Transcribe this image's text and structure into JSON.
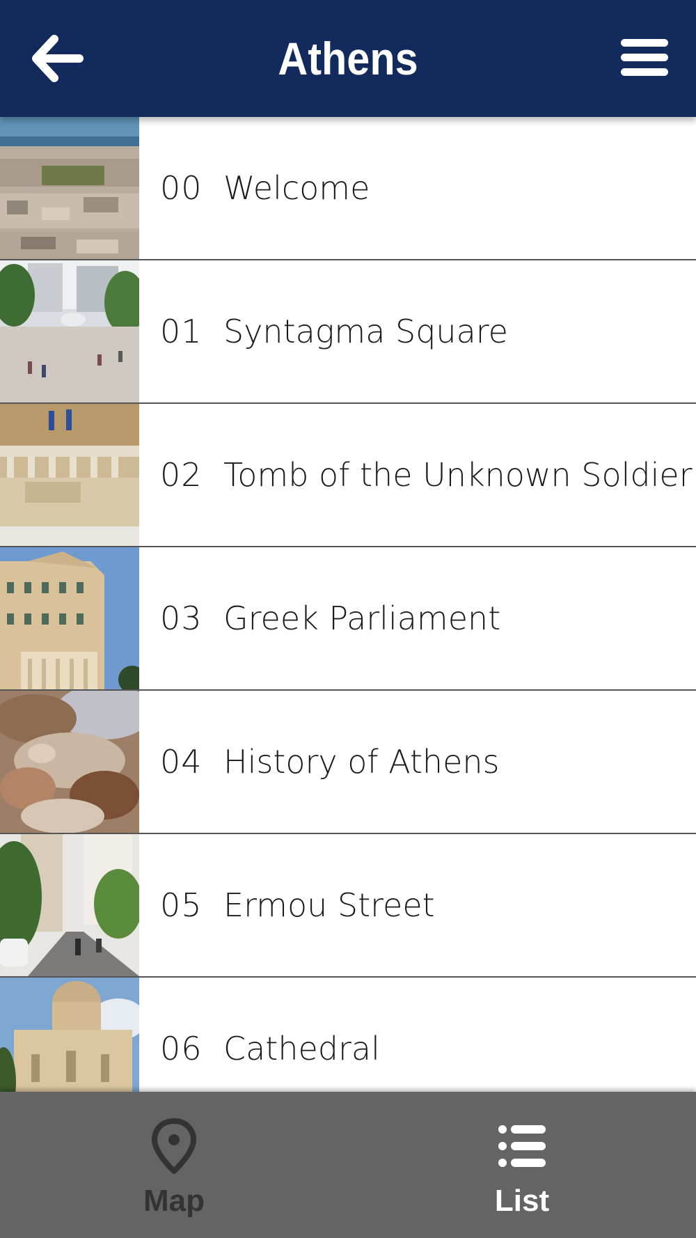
{
  "header": {
    "title": "Athens",
    "back_icon": "arrow-left-icon",
    "menu_icon": "hamburger-menu-icon",
    "background_color": "#122a5c"
  },
  "list": {
    "items": [
      {
        "number": "00",
        "title": "Welcome",
        "thumbnail": "city-aerial-photo"
      },
      {
        "number": "01",
        "title": "Syntagma Square",
        "thumbnail": "square-photo"
      },
      {
        "number": "02",
        "title": "Tomb of the Unknown Soldier",
        "thumbnail": "monument-photo"
      },
      {
        "number": "03",
        "title": "Greek Parliament",
        "thumbnail": "parliament-photo"
      },
      {
        "number": "04",
        "title": "History of Athens",
        "thumbnail": "painting-photo"
      },
      {
        "number": "05",
        "title": "Ermou Street",
        "thumbnail": "street-photo"
      },
      {
        "number": "06",
        "title": "Cathedral",
        "thumbnail": "cathedral-photo"
      }
    ]
  },
  "tabbar": {
    "background_color": "#646464",
    "tabs": [
      {
        "label": "Map",
        "icon": "map-pin-icon",
        "active": false
      },
      {
        "label": "List",
        "icon": "list-icon",
        "active": true
      }
    ]
  }
}
